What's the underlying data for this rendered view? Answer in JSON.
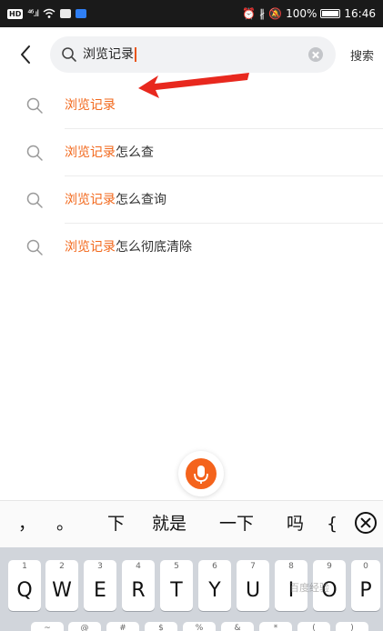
{
  "status_bar": {
    "hd": "HD",
    "signal": "⁴⁶.ıl",
    "alarm": "⏰",
    "bt": "∦",
    "mute": "🔕",
    "battery": "100%",
    "time": "16:46"
  },
  "search": {
    "query": "浏览记录",
    "button": "搜索"
  },
  "icons": {
    "back": "chevron-left-icon",
    "search": "magnifier-icon",
    "clear": "clear-icon",
    "mic": "microphone-icon"
  },
  "suggestions": [
    {
      "highlight": "浏览记录",
      "rest": ""
    },
    {
      "highlight": "浏览记录",
      "rest": "怎么查"
    },
    {
      "highlight": "浏览记录",
      "rest": "怎么查询"
    },
    {
      "highlight": "浏览记录",
      "rest": "怎么彻底清除"
    }
  ],
  "candidates": [
    "，",
    "。",
    "下",
    "就是",
    "一下",
    "吗",
    "{"
  ],
  "keys": [
    {
      "num": "1",
      "ch": "Q"
    },
    {
      "num": "2",
      "ch": "W"
    },
    {
      "num": "3",
      "ch": "E"
    },
    {
      "num": "4",
      "ch": "R"
    },
    {
      "num": "5",
      "ch": "T"
    },
    {
      "num": "6",
      "ch": "Y"
    },
    {
      "num": "7",
      "ch": "U"
    },
    {
      "num": "8",
      "ch": "I"
    },
    {
      "num": "9",
      "ch": "O"
    },
    {
      "num": "0",
      "ch": "P"
    }
  ],
  "keys_row2": [
    "~",
    "@",
    "#",
    "$",
    "%",
    "&",
    "*",
    "(",
    ")"
  ],
  "watermark": "百度经验",
  "colors": {
    "accent": "#f2681c",
    "arrow": "#e8281e",
    "mic": "#f4631c"
  }
}
